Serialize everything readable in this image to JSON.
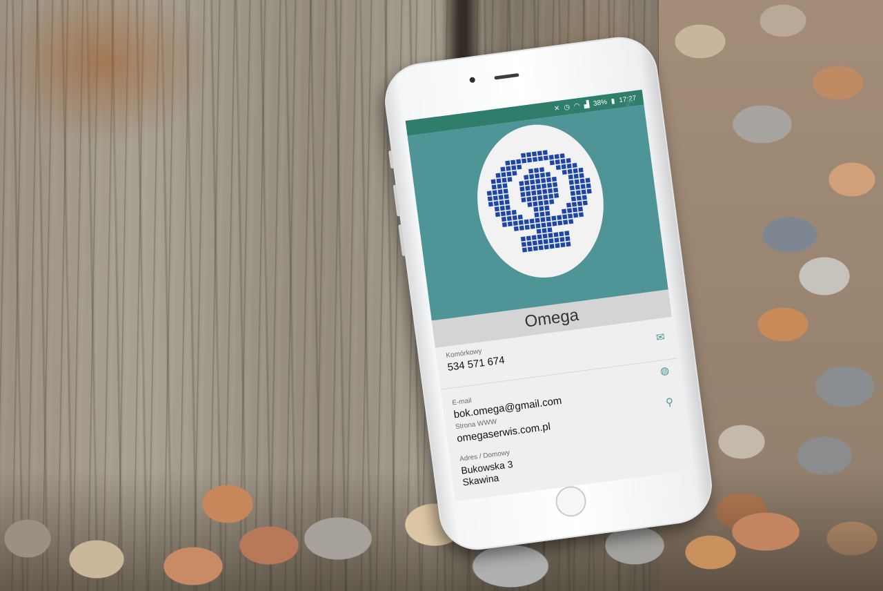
{
  "status_bar": {
    "icons": [
      "mute-icon",
      "alarm-icon",
      "wifi-icon",
      "signal-icon"
    ],
    "battery": "38%",
    "time": "17:27"
  },
  "contact": {
    "name": "Omega",
    "phone_label": "Komórkowy",
    "phone": "534 571 674",
    "email_label": "E-mail",
    "email": "bok.omega@gmail.com",
    "web_label": "Strona WWW",
    "web": "omegaserwis.com.pl",
    "address_label": "Adres / Domowy",
    "address_line1": "Bukowska 3",
    "address_line2": "Skawina"
  },
  "colors": {
    "status_bar": "#2f7d6b",
    "header": "#4f9598",
    "logo": "#1e46a8",
    "name_bar": "#d4d4d4"
  },
  "icons": {
    "call": "phone-icon",
    "message": "message-icon",
    "web": "globe-icon",
    "map": "map-pin-icon",
    "logo": "omega-logo"
  }
}
